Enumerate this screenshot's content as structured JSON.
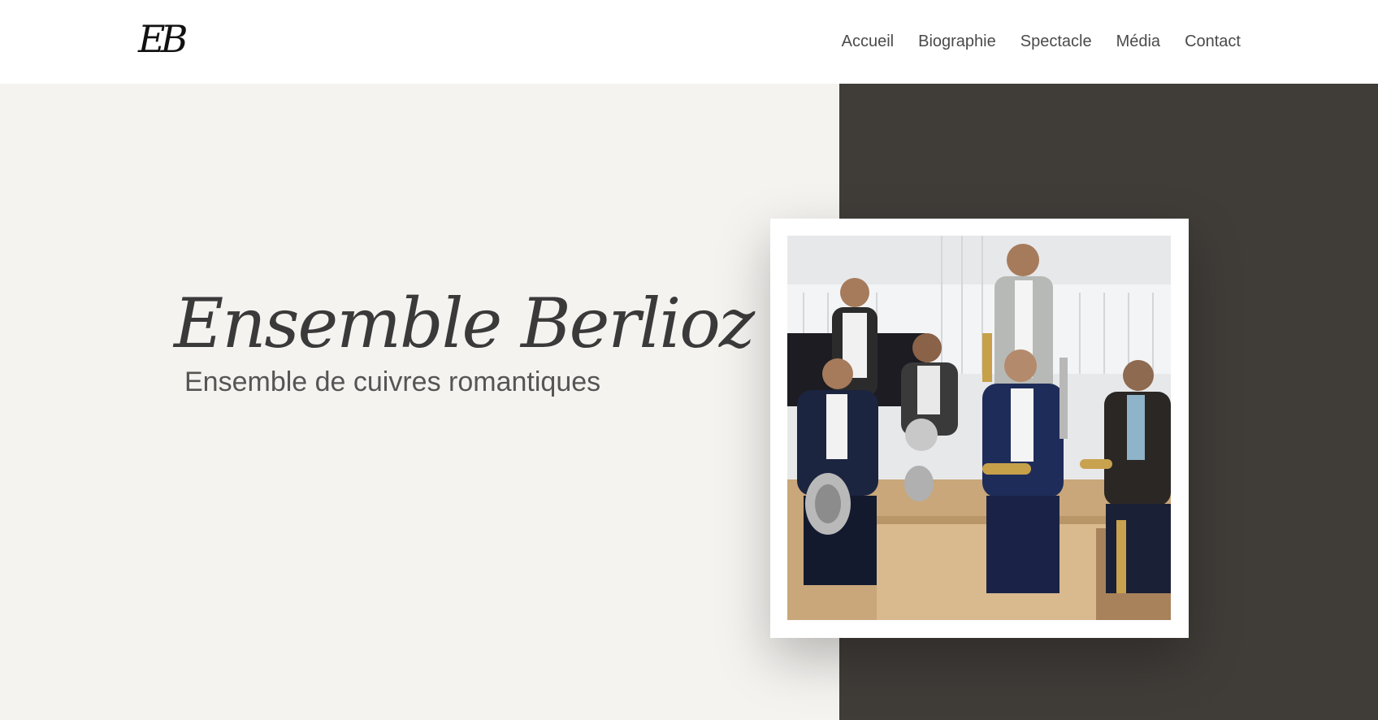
{
  "header": {
    "logo_text": "EB",
    "nav": [
      "Accueil",
      "Biographie",
      "Spectacle",
      "Média",
      "Contact"
    ]
  },
  "hero": {
    "title": "Ensemble Berlioz",
    "subtitle": "Ensemble de cuivres romantiques"
  },
  "colors": {
    "left_panel": "#f4f3f0",
    "right_panel": "#403c38",
    "nav_text": "#4a4a4a"
  }
}
